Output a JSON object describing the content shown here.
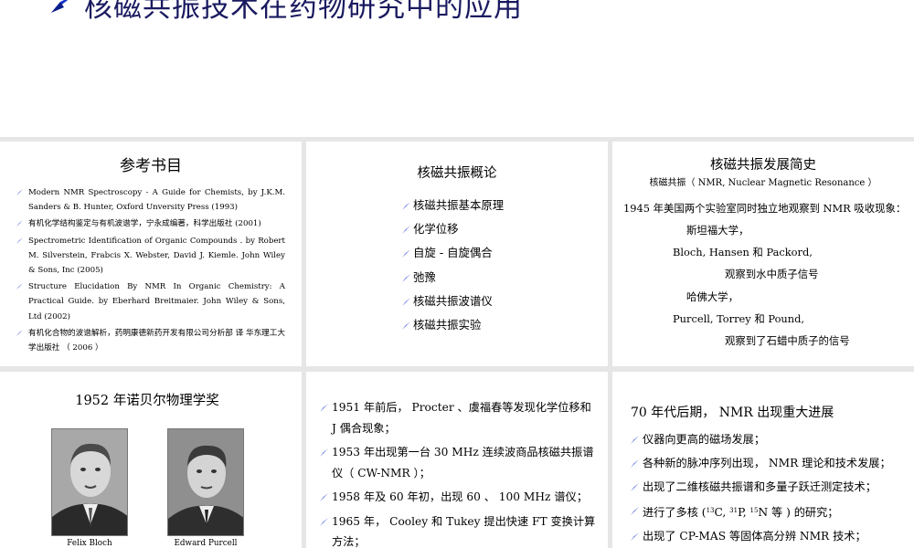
{
  "header": {
    "title": "核磁共振技术在药物研究中的应用",
    "title_color": "#1a1a60",
    "arrow_color": "#1533cc"
  },
  "references": {
    "title": "参考书目",
    "items": [
      "Modern NMR Spectroscopy - A Guide for Chemists, by J.K.M. Sanders  & B. Hunter, Oxford Unversity Press (1993)",
      "有机化学结构鉴定与有机波谱学，宁永成编著，科学出版社  (2001)",
      "Spectrometric Identification of Organic Compounds . by Robert M. Silverstein, Frabcis X. Webster, David J. Kiemle. John Wiley & Sons, Inc (2005)",
      "Structure Elucidation By NMR In Organic Chemistry: A Practical Guide. by Eberhard Breitmaier. John Wiley & Sons, Ltd (2002)",
      "有机化合物的波谱解析，药明康德新药开发有限公司分析部  译    华东理工大学出版社  （ 2006 ）"
    ]
  },
  "overview": {
    "title": "核磁共振概论",
    "items": [
      "核磁共振基本原理",
      "化学位移",
      "自旋 - 自旋偶合",
      "弛豫",
      "核磁共振波谱仪",
      "核磁共振实验"
    ]
  },
  "history": {
    "title": "核磁共振发展简史",
    "subtitle": "核磁共振（ NMR, Nuclear Magnetic Resonance ）",
    "line1": "1945 年美国两个实验室同时独立地观察到 NMR 吸收现象：",
    "line2": "斯坦福大学，",
    "line3": "Bloch, Hansen  和    Packord,",
    "line4": "观察到水中质子信号",
    "line5": "哈佛大学，",
    "line6": "Purcell, Torrey  和    Pound,",
    "line7": "观察到了石蜡中质子的信号"
  },
  "nobel": {
    "title": "1952 年诺贝尔物理学奖",
    "caption1": "Felix Bloch",
    "caption2": "Edward Purcell"
  },
  "milestones": {
    "items": [
      "1951 年前后， Procter 、虞福春等发现化学位移和 J 偶合现象；",
      "1953 年出现第一台 30 MHz 连续波商品核磁共振谱仪（ CW-NMR ）；",
      "1958 年及 60 年初，出现 60 、 100 MHz 谱仪；",
      "1965 年， Cooley 和 Tukey 提出快速 FT 变换计算方法；"
    ]
  },
  "seventies": {
    "title": "70 年代后期， NMR 出现重大进展",
    "items": [
      "仪器向更高的磁场发展；",
      "各种新的脉冲序列出现， NMR 理论和技术发展；",
      "出现了二维核磁共振谱和多量子跃迁测定技术；"
    ],
    "item4_pre": "进行了多核 (",
    "item4_sup1": "13",
    "item4_mid1": "C, ",
    "item4_sup2": "31",
    "item4_mid2": "P, ",
    "item4_sup3": "15",
    "item4_post": "N 等 ) 的研究；",
    "item5": "出现了 CP-MAS 等固体高分辨 NMR 技术；"
  }
}
